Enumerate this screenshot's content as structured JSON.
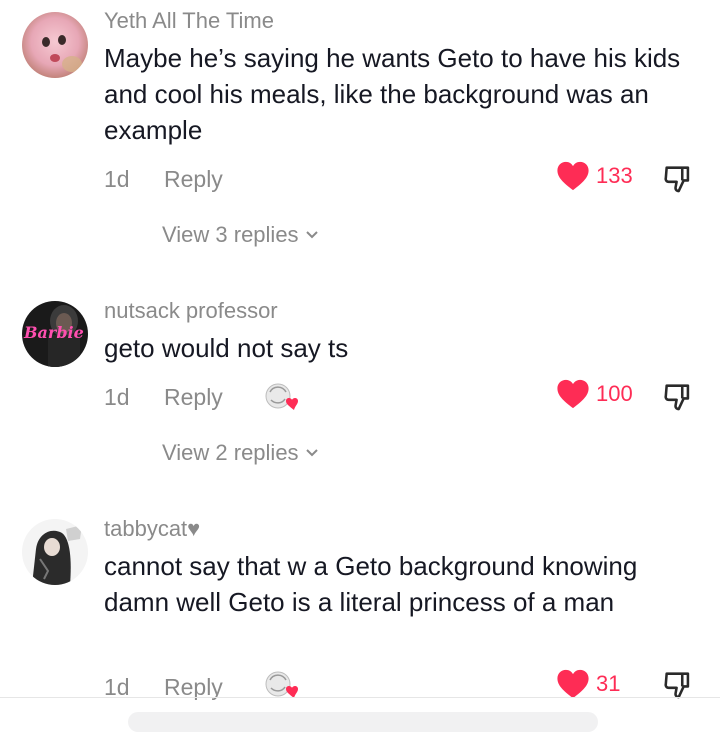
{
  "comments": [
    {
      "username": "Yeth All The Time",
      "text": "Maybe he’s saying he wants Geto to have his kids and cool his meals, like the background was an example",
      "age": "1d",
      "reply_label": "Reply",
      "likes": "133",
      "liked": true,
      "view_replies": "View 3 replies"
    },
    {
      "username": "nutsack professor",
      "avatar_text": "Barbie",
      "text": "geto would not say ts",
      "age": "1d",
      "reply_label": "Reply",
      "creator_liked": true,
      "likes": "100",
      "liked": true,
      "view_replies": "View 2 replies"
    },
    {
      "username": "tabbycat♥",
      "text": "cannot say that w a Geto background knowing damn well Geto is a literal princess of a man",
      "age": "1d",
      "reply_label": "Reply",
      "creator_liked": true,
      "likes": "31",
      "liked": true
    }
  ],
  "colors": {
    "like": "#fe2c55",
    "muted": "#8a8a8a",
    "text": "#161823"
  },
  "icons": {
    "like": "heart-icon",
    "dislike": "thumbs-down-icon",
    "chevron": "chevron-down-icon",
    "creator_like": "creator-liked-icon"
  }
}
